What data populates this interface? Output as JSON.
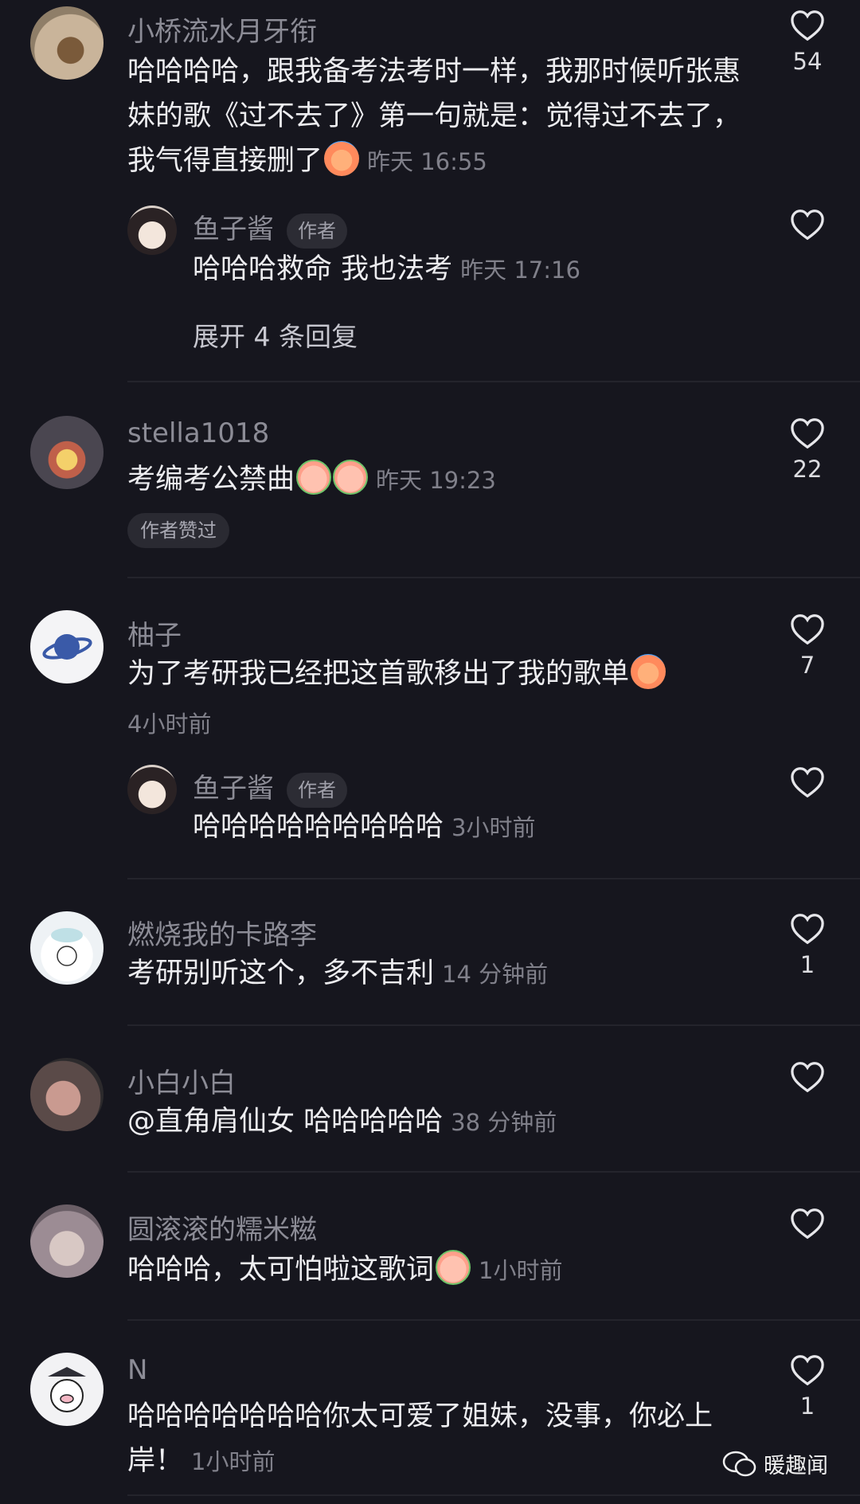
{
  "comments": [
    {
      "user": "小桥流水月牙衔",
      "text": "哈哈哈哈，跟我备考法考时一样，我那时候听张惠妹的歌《过不去了》第一句就是：觉得过不去了，我气得直接删了",
      "time": "昨天 16:55",
      "likes": "54",
      "avatar_icon": "dog-photo-avatar",
      "reply": {
        "user": "鱼子酱",
        "badge": "作者",
        "text": "哈哈哈救命 我也法考",
        "time": "昨天 17:16",
        "avatar_icon": "girl-illustration-avatar"
      },
      "expand": "展开 4 条回复"
    },
    {
      "user": "stella1018",
      "text": "考编考公禁曲",
      "time": "昨天 19:23",
      "likes": "22",
      "avatar_icon": "witch-hat-avatar",
      "tag": "作者赞过"
    },
    {
      "user": "柚子",
      "text": "为了考研我已经把这首歌移出了我的歌单",
      "time": "4小时前",
      "likes": "7",
      "avatar_icon": "planet-avatar",
      "reply": {
        "user": "鱼子酱",
        "badge": "作者",
        "text": "哈哈哈哈哈哈哈哈哈",
        "time": "3小时前",
        "avatar_icon": "girl-illustration-avatar"
      }
    },
    {
      "user": "燃烧我的卡路李",
      "text": "考研别听这个，多不吉利",
      "time": "14 分钟前",
      "likes": "1",
      "avatar_icon": "cartoon-cloud-avatar"
    },
    {
      "user": "小白小白",
      "text": "@直角肩仙女 哈哈哈哈哈",
      "time": "38 分钟前",
      "likes": "",
      "avatar_icon": "hand-photo-avatar"
    },
    {
      "user": "圆滚滚的糯米糍",
      "text": "哈哈哈，太可怕啦这歌词",
      "time": "1小时前",
      "likes": "",
      "avatar_icon": "room-photo-avatar"
    },
    {
      "user": "N",
      "text": "哈哈哈哈哈哈哈你太可爱了姐妹，没事，你必上岸！",
      "time": "1小时前",
      "likes": "1",
      "avatar_icon": "pig-cartoon-avatar"
    }
  ],
  "watermark": "暖趣闻",
  "colors": {
    "background": "#16161e",
    "muted": "#8c8c96",
    "text": "#ededf0"
  }
}
